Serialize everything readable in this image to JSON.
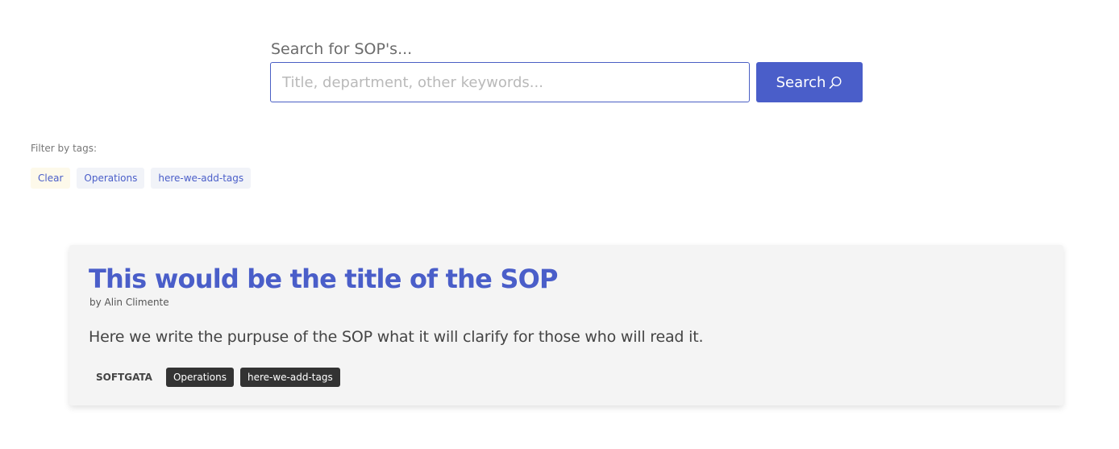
{
  "search": {
    "label": "Search for SOP's...",
    "placeholder": "Title, department, other keywords...",
    "value": "",
    "button_label": "Search",
    "button_icon": "search-icon"
  },
  "filter": {
    "label": "Filter by tags:",
    "clear_label": "Clear",
    "tags": [
      "Operations",
      "here-we-add-tags"
    ]
  },
  "sop_card": {
    "title": "This would be the title of the SOP",
    "author": "by Alin Climente",
    "description": "Here we write the purpuse of the SOP what it will clarify for those who will read it.",
    "company": "SOFTGATA",
    "tags": [
      "Operations",
      "here-we-add-tags"
    ]
  },
  "colors": {
    "accent": "#4a5ec9",
    "card_background": "#f4f4f4",
    "tag_dark": "#333333",
    "clear_tag_background": "#fdf9ea"
  }
}
